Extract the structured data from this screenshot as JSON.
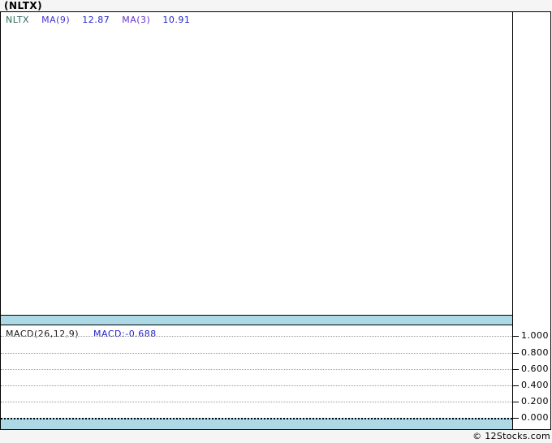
{
  "page": {
    "title": "(NLTX)",
    "footer": "© 12Stocks.com"
  },
  "price_panel": {
    "legend": {
      "ticker": "NLTX",
      "ma9_label": "MA(9)",
      "ma9_value": "12.87",
      "ma3_label": "MA(3)",
      "ma3_value": "10.91"
    }
  },
  "macd_panel": {
    "indicator_label": "MACD(26,12,9)",
    "indicator_value": "MACD:-0.688",
    "axis_ticks": [
      "1.000",
      "0.800",
      "0.600",
      "0.400",
      "0.200",
      "0.000"
    ]
  },
  "colors": {
    "page_background": "#f5f5f5",
    "panel_background": "#ffffff",
    "band_blue": "#add8e6",
    "ticker_green": "#2f6b5e",
    "ma_label_blue": "#4433cc",
    "ma3_label_purple": "#6633cc",
    "value_blue": "#2222cc",
    "border_black": "#000000",
    "gridline_gray": "#999999"
  },
  "chart_data": [
    {
      "type": "line",
      "title": "(NLTX)",
      "panel": "price",
      "series": [
        {
          "name": "NLTX",
          "values": []
        },
        {
          "name": "MA(9)",
          "last_value": 12.87,
          "values": []
        },
        {
          "name": "MA(3)",
          "last_value": 10.91,
          "values": []
        }
      ],
      "note": "Price panel renders empty - no visible candles, lines or axis labels in screenshot"
    },
    {
      "type": "line",
      "title": "MACD(26,12,9)",
      "panel": "indicator",
      "series": [
        {
          "name": "MACD",
          "last_value": -0.688,
          "values": []
        }
      ],
      "ylabel": "",
      "ytick_labels": [
        "1.000",
        "0.800",
        "0.600",
        "0.400",
        "0.200",
        "0.000"
      ],
      "ylim": [
        0.0,
        1.0
      ],
      "grid": "dotted horizontal, zero line dense dotted",
      "legend_position": "top-left",
      "note": "No MACD curve visible; only gridlines, axis ticks and legend values shown"
    }
  ]
}
